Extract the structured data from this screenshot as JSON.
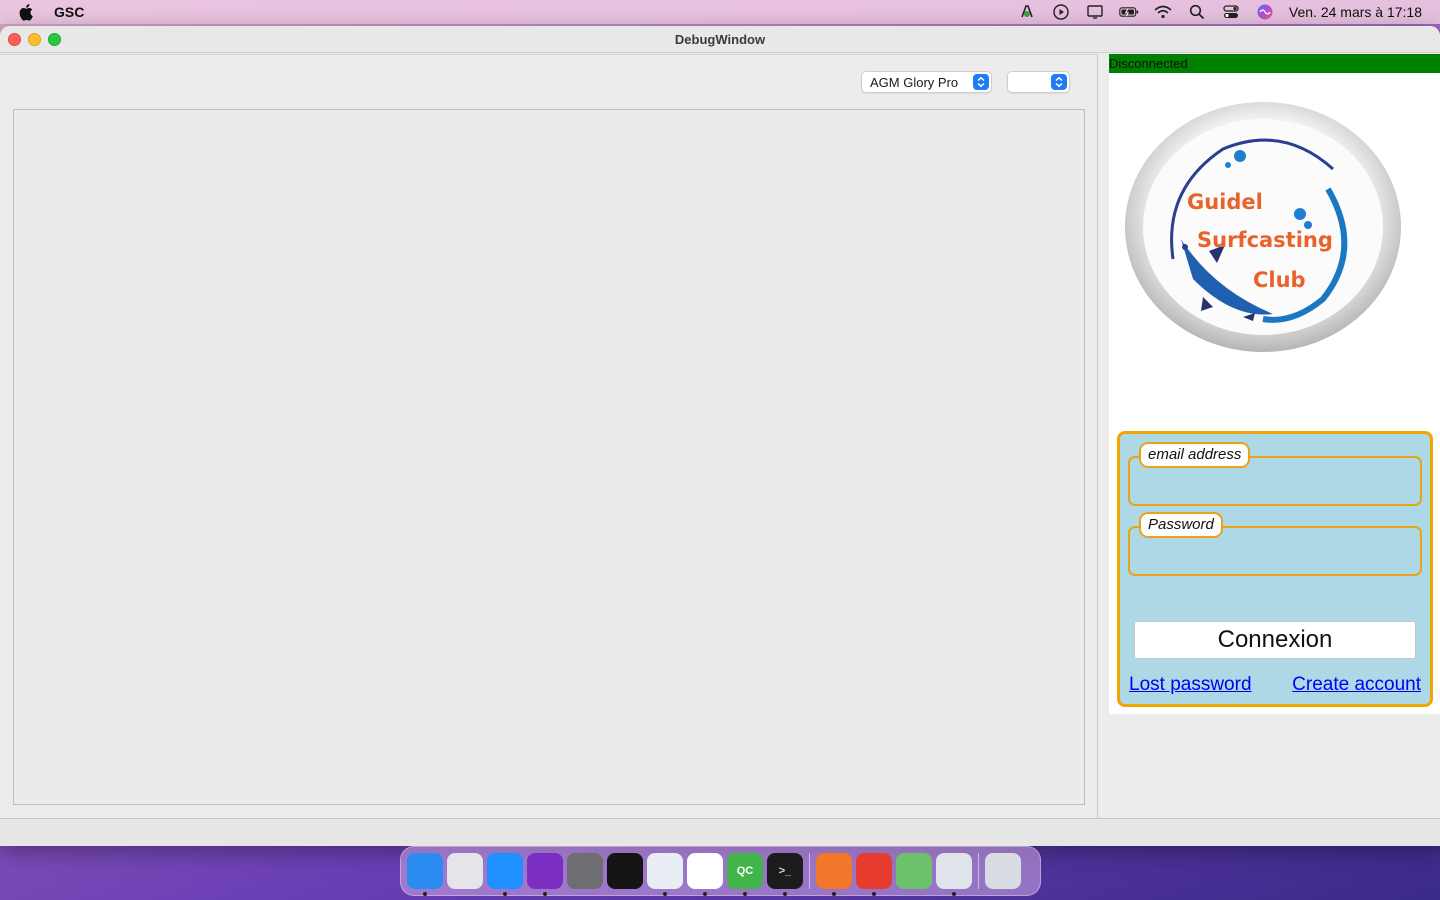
{
  "menubar": {
    "app_name": "GSC",
    "clock": "Ven. 24 mars à  17:18"
  },
  "window": {
    "title": "DebugWindow"
  },
  "toolbar": {
    "model_combo_value": "AGM Glory Pro",
    "port_combo_value": ""
  },
  "status": {
    "text": "Disconnected",
    "color": "#008000"
  },
  "logo": {
    "line1": "Guidel",
    "line2": "Surfcasting",
    "line3": "Club"
  },
  "login": {
    "email_label": "email address",
    "email_value": "",
    "password_label": "Password",
    "password_value": "",
    "connect_button": "Connexion",
    "lost_password_link": "Lost password",
    "create_account_link": "Create account",
    "panel_color": "#add8e6",
    "border_color": "#f0a500"
  },
  "dock": {
    "apps": [
      {
        "name": "finder-icon",
        "label": "",
        "color": "#2a8cf0",
        "running": true
      },
      {
        "name": "launchpad-icon",
        "label": "",
        "color": "#e4e4ea",
        "running": false
      },
      {
        "name": "safari-icon",
        "label": "",
        "color": "#1e90ff",
        "running": true
      },
      {
        "name": "firefox-icon",
        "label": "",
        "color": "#7a2fc2",
        "running": true
      },
      {
        "name": "system-preferences-icon",
        "label": "",
        "color": "#6d6d72",
        "running": false
      },
      {
        "name": "deezer-icon",
        "label": "",
        "color": "#141414",
        "running": false
      },
      {
        "name": "brush-app-icon",
        "label": "",
        "color": "#e9eef5",
        "running": true
      },
      {
        "name": "vscode-icon",
        "label": "",
        "color": "#ffffff",
        "running": true
      },
      {
        "name": "qt-creator-icon",
        "label": "QC",
        "color": "#41b549",
        "running": true
      },
      {
        "name": "terminal-icon",
        "label": ">_",
        "color": "#1c1c1c",
        "running": true
      },
      {
        "name": "pages-icon",
        "label": "",
        "color": "#f2772b",
        "running": true
      },
      {
        "name": "matlab-icon",
        "label": "",
        "color": "#e63b2e",
        "running": true
      },
      {
        "name": "maps-icon",
        "label": "",
        "color": "#6cc26b",
        "running": false
      },
      {
        "name": "blank-app-icon",
        "label": "",
        "color": "#dfe3ea",
        "running": true
      },
      {
        "name": "trash-icon",
        "label": "",
        "color": "#d8dde4",
        "running": false
      }
    ]
  }
}
